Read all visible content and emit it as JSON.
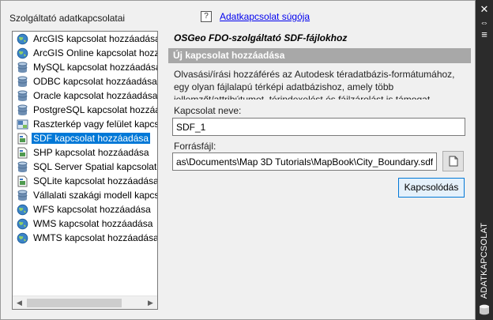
{
  "panel": {
    "left_title": "Szolgáltató adatkapcsolatai",
    "help_icon": "?",
    "help_link": "Adatkapcsolat súgója"
  },
  "providers": [
    {
      "label": "ArcGIS kapcsolat hozzáadása",
      "icon": "globe-icon"
    },
    {
      "label": "ArcGIS Online kapcsolat hozzá",
      "icon": "globe-icon"
    },
    {
      "label": "MySQL kapcsolat hozzáadása",
      "icon": "database-icon"
    },
    {
      "label": "ODBC kapcsolat hozzáadása",
      "icon": "database-icon"
    },
    {
      "label": "Oracle kapcsolat hozzáadása",
      "icon": "database-icon"
    },
    {
      "label": "PostgreSQL kapcsolat hozzáad",
      "icon": "database-icon"
    },
    {
      "label": "Raszterkép vagy felület kapcso",
      "icon": "raster-icon"
    },
    {
      "label": "SDF kapcsolat hozzáadása",
      "icon": "file-icon",
      "selected": true
    },
    {
      "label": "SHP kapcsolat hozzáadása",
      "icon": "file-icon"
    },
    {
      "label": "SQL Server Spatial kapcsolat h",
      "icon": "database-icon"
    },
    {
      "label": "SQLite kapcsolat hozzáadása",
      "icon": "file-icon"
    },
    {
      "label": "Vállalati szakági modell kapcs",
      "icon": "database-icon"
    },
    {
      "label": "WFS kapcsolat hozzáadása",
      "icon": "globe-icon"
    },
    {
      "label": "WMS kapcsolat hozzáadása",
      "icon": "globe-icon"
    },
    {
      "label": "WMTS kapcsolat hozzáadása",
      "icon": "globe-icon"
    }
  ],
  "scroll": {
    "left_arrow": "◀",
    "right_arrow": "▶"
  },
  "detail": {
    "title": "OSGeo FDO-szolgáltató SDF-fájlokhoz",
    "section": "Új kapcsolat hozzáadása",
    "description_lines": [
      "Olvasási/írási hozzáférés az Autodesk téradatbázis-formátumához,",
      "egy olyan fájlalapú térképi adatbázishoz, amely több",
      "jellemzőt/attribútumot, térindexelést és fájlzárolást is támogat."
    ],
    "connection_name_label": "Kapcsolat neve:",
    "connection_name_value": "SDF_1",
    "source_file_label": "Forrásfájl:",
    "source_file_value": "as\\Documents\\Map 3D Tutorials\\MapBook\\City_Boundary.sdf",
    "connect_button": "Kapcsolódás"
  },
  "sidebar": {
    "close": "✕",
    "pin": "⇔",
    "menu": "≡",
    "title": "ADATKAPCSOLAT"
  },
  "colors": {
    "selection": "#0078d7",
    "section_bar": "#a8a8a8",
    "sidebar": "#2b2b2b",
    "link": "#0000ee"
  }
}
